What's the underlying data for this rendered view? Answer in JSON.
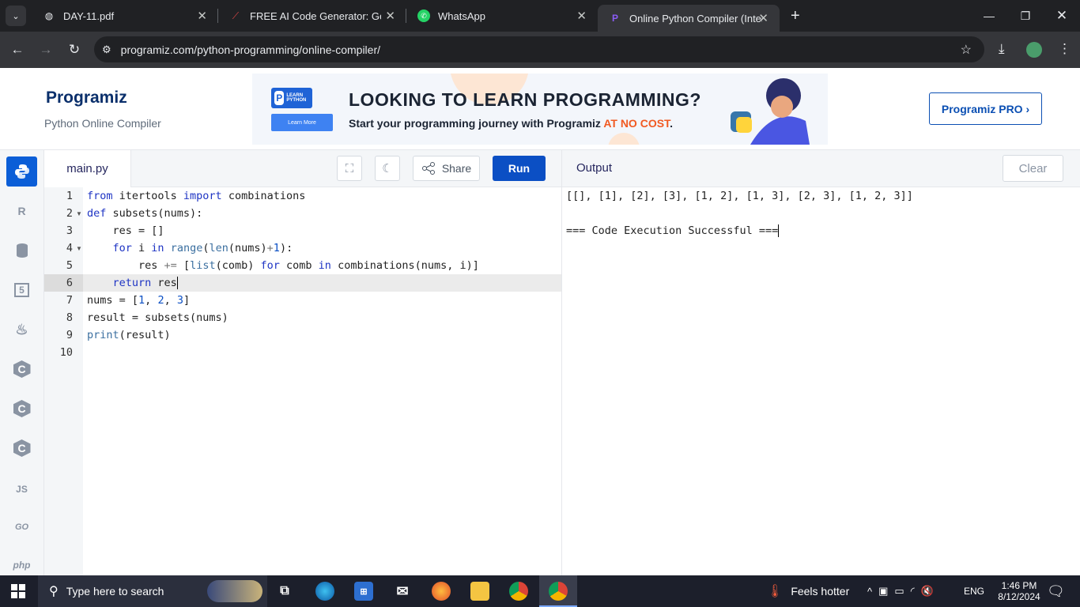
{
  "browser": {
    "tabs": [
      {
        "title": "DAY-11.pdf",
        "icon": "globe-icon"
      },
      {
        "title": "FREE AI Code Generator: Generate",
        "icon": "ai-logo-icon"
      },
      {
        "title": "WhatsApp",
        "icon": "whatsapp-icon"
      },
      {
        "title": "Online Python Compiler (Interpreter)",
        "icon": "programiz-icon",
        "active": true
      }
    ],
    "url": "programiz.com/python-programming/online-compiler/"
  },
  "site": {
    "logo": "Programiz",
    "subtitle": "Python Online Compiler",
    "pro_button": "Programiz PRO ›",
    "banner": {
      "badge": "LEARN PYTHON",
      "learn_more": "Learn More",
      "headline": "LOOKING TO LEARN PROGRAMMING?",
      "sub_pre": "Start your programming journey with Programiz ",
      "sub_highlight": "AT NO COST",
      "sub_post": "."
    }
  },
  "sidebar": {
    "items": [
      {
        "name": "python",
        "icon": "python-icon",
        "label": "",
        "active": true
      },
      {
        "name": "r",
        "icon": "r-icon",
        "label": "R"
      },
      {
        "name": "sql",
        "icon": "database-icon",
        "label": ""
      },
      {
        "name": "html",
        "icon": "html5-icon",
        "label": "5"
      },
      {
        "name": "java",
        "icon": "java-icon",
        "label": "♨"
      },
      {
        "name": "c",
        "icon": "c-icon",
        "label": "C"
      },
      {
        "name": "cpp",
        "icon": "cpp-icon",
        "label": "C"
      },
      {
        "name": "csharp",
        "icon": "csharp-icon",
        "label": "C"
      },
      {
        "name": "js",
        "icon": "js-icon",
        "label": "JS"
      },
      {
        "name": "go",
        "icon": "go-icon",
        "label": "GO"
      },
      {
        "name": "php",
        "icon": "php-icon",
        "label": "php"
      }
    ]
  },
  "editor": {
    "filename": "main.py",
    "share_label": "Share",
    "run_label": "Run",
    "line_numbers": [
      "1",
      "2",
      "3",
      "4",
      "5",
      "6",
      "7",
      "8",
      "9",
      "10"
    ],
    "active_line": 6
  },
  "output": {
    "title": "Output",
    "clear_label": "Clear",
    "lines": [
      "[[], [1], [2], [3], [1, 2], [1, 3], [2, 3], [1, 2, 3]]",
      "",
      "=== Code Execution Successful ==="
    ]
  },
  "taskbar": {
    "search_placeholder": "Type here to search",
    "weather": "Feels hotter",
    "language": "ENG",
    "time": "1:46 PM",
    "date": "8/12/2024"
  },
  "colors": {
    "accent": "#0b4fc4",
    "active_sidebar": "#0b5ed7",
    "keyword": "#1e34c4",
    "highlight": "#f15a22"
  }
}
